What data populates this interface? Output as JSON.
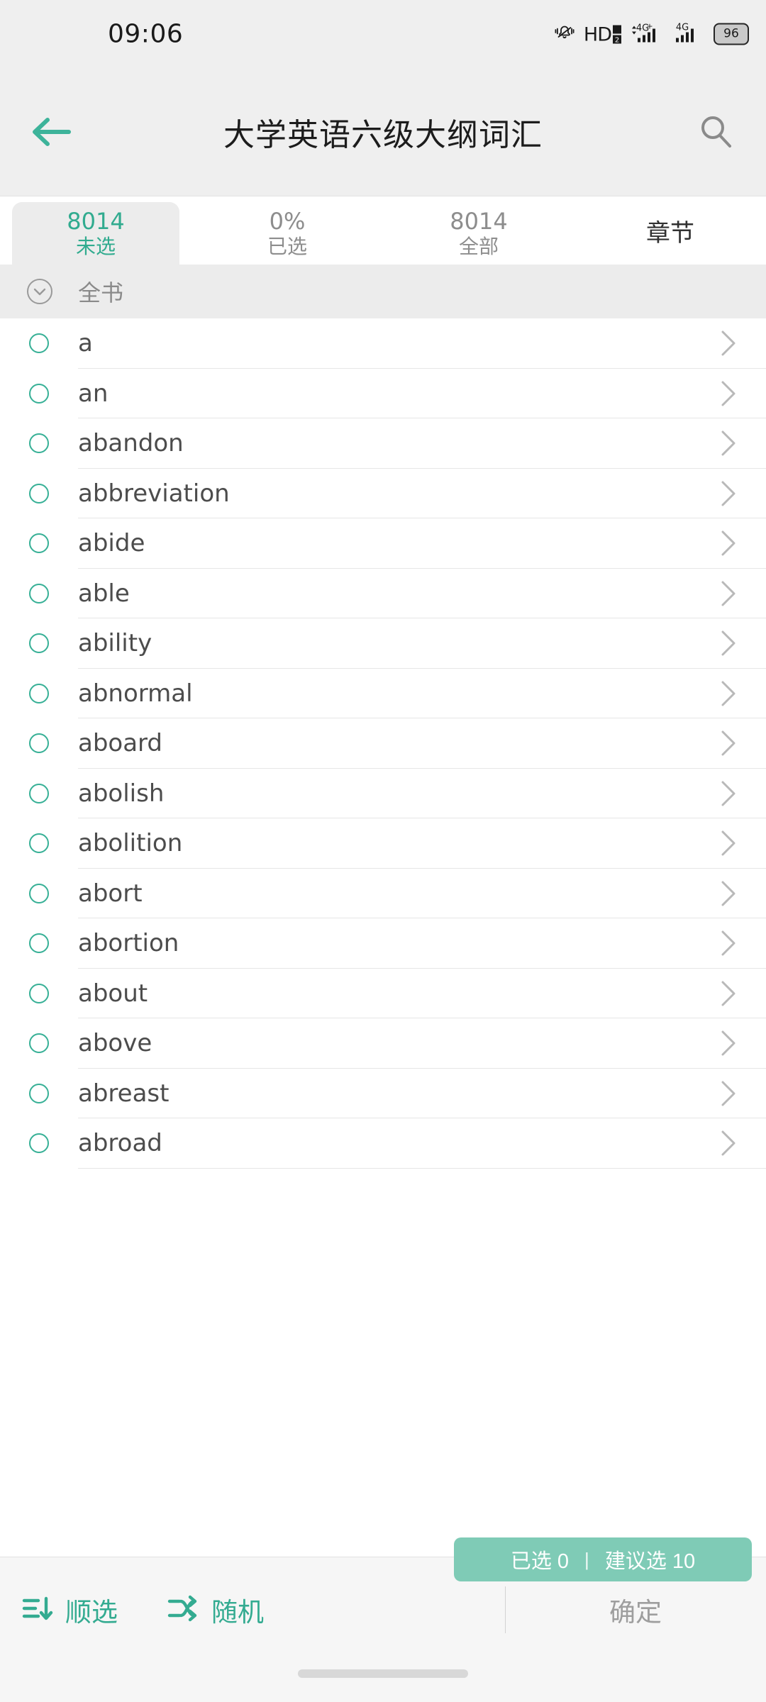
{
  "status_bar": {
    "time": "09:06",
    "icons": [
      "vibrate-icon",
      "hd-voice-icon",
      "signal-4g-plus-icon",
      "signal-4g-icon",
      "battery-icon"
    ],
    "hd_label": "HD",
    "sim_label": "2",
    "network_label_1": "4G+",
    "network_label_2": "4G",
    "battery_percent": "96"
  },
  "title_bar": {
    "back_icon": "arrow-left-icon",
    "title": "大学英语六级大纲词汇",
    "search_icon": "search-icon"
  },
  "tabs": [
    {
      "value": "8014",
      "label": "未选",
      "selected": true
    },
    {
      "value": "0%",
      "label": "已选",
      "selected": false
    },
    {
      "value": "8014",
      "label": "全部",
      "selected": false
    },
    {
      "value": "",
      "label": "章节",
      "selected": false,
      "single": true
    }
  ],
  "section": {
    "chevron_icon": "chevron-down-circle-icon",
    "title": "全书"
  },
  "words": [
    {
      "text": "a"
    },
    {
      "text": "an"
    },
    {
      "text": "abandon"
    },
    {
      "text": "abbreviation"
    },
    {
      "text": "abide"
    },
    {
      "text": "able"
    },
    {
      "text": "ability"
    },
    {
      "text": "abnormal"
    },
    {
      "text": "aboard"
    },
    {
      "text": "abolish"
    },
    {
      "text": "abolition"
    },
    {
      "text": "abort"
    },
    {
      "text": "abortion"
    },
    {
      "text": "about"
    },
    {
      "text": "above"
    },
    {
      "text": "abreast"
    },
    {
      "text": "abroad"
    }
  ],
  "float_pill": {
    "selected_text": "已选 0",
    "separator": "|",
    "suggested_text": "建议选 10"
  },
  "bottom_bar": {
    "sort_icon": "sort-descending-icon",
    "sort_label": "顺选",
    "random_icon": "shuffle-icon",
    "random_label": "随机",
    "confirm_label": "确定"
  },
  "colors": {
    "accent": "#34ab91",
    "pill": "#7fcbb6",
    "header_bg": "#efefef",
    "section_bg": "#ececec",
    "muted_text": "#8d8d8d"
  }
}
